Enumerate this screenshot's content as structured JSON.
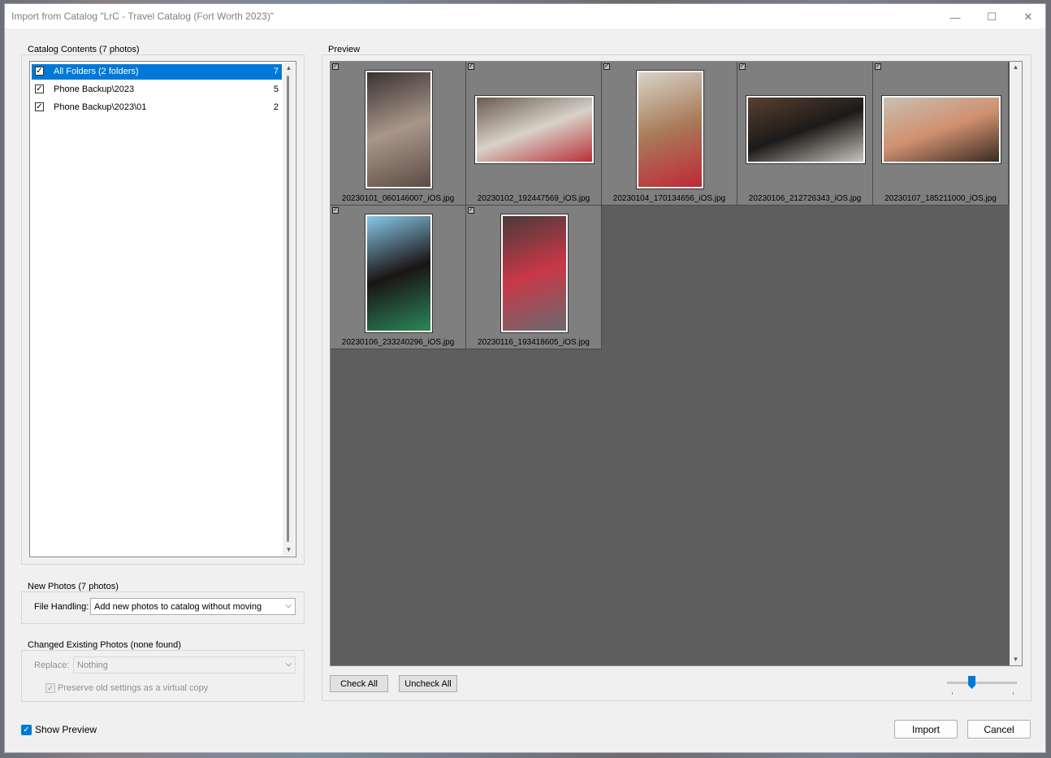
{
  "window": {
    "title": "Import from Catalog \"LrC - Travel Catalog (Fort Worth 2023)\"",
    "controls": {
      "minimize": "—",
      "maximize": "☐",
      "close": "✕"
    }
  },
  "catalog": {
    "group_label": "Catalog Contents (7 photos)",
    "folders": [
      {
        "label": "All Folders (2 folders)",
        "count": "7",
        "checked": true,
        "selected": true
      },
      {
        "label": "Phone Backup\\2023",
        "count": "5",
        "checked": true,
        "selected": false
      },
      {
        "label": "Phone Backup\\2023\\01",
        "count": "2",
        "checked": true,
        "selected": false
      }
    ]
  },
  "new_photos": {
    "group_label": "New Photos (7 photos)",
    "file_handling_label": "File Handling:",
    "file_handling_value": "Add new photos to catalog without moving"
  },
  "changed_photos": {
    "group_label": "Changed Existing Photos (none found)",
    "replace_label": "Replace:",
    "replace_value": "Nothing",
    "preserve_label": "Preserve old settings as a virtual copy"
  },
  "preview": {
    "group_label": "Preview",
    "photos": [
      {
        "filename": "20230101_060146007_iOS.jpg",
        "orientation": "portrait",
        "colors": [
          "#3a3230",
          "#a8968a",
          "#5b4c44"
        ]
      },
      {
        "filename": "20230102_192447569_iOS.jpg",
        "orientation": "landscape",
        "colors": [
          "#6a5a50",
          "#d8d2c8",
          "#b8303a"
        ]
      },
      {
        "filename": "20230104_170134656_iOS.jpg",
        "orientation": "portrait",
        "colors": [
          "#d8d4c8",
          "#a87a58",
          "#c02838"
        ]
      },
      {
        "filename": "20230106_212726343_iOS.jpg",
        "orientation": "landscape",
        "colors": [
          "#5a4030",
          "#1c1a18",
          "#c8c4bc"
        ]
      },
      {
        "filename": "20230107_185211000_iOS.jpg",
        "orientation": "landscape",
        "colors": [
          "#c8c0b0",
          "#d09070",
          "#3a2a22"
        ]
      },
      {
        "filename": "20230106_233240296_iOS.jpg",
        "orientation": "portrait",
        "colors": [
          "#88c8e8",
          "#1a1414",
          "#2a8858"
        ]
      },
      {
        "filename": "20230116_193418605_iOS.jpg",
        "orientation": "portrait",
        "colors": [
          "#4a3a3a",
          "#c83848",
          "#6a6a70"
        ]
      }
    ],
    "check_all": "Check All",
    "uncheck_all": "Uncheck All"
  },
  "footer": {
    "show_preview": "Show Preview",
    "import": "Import",
    "cancel": "Cancel"
  },
  "accent": "#0078d7"
}
